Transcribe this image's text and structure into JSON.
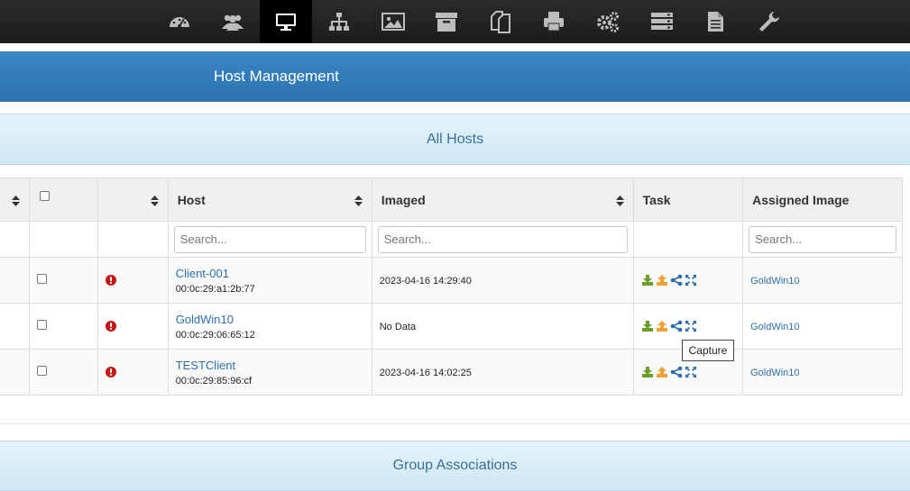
{
  "nav": {
    "items": [
      {
        "name": "dashboard-icon"
      },
      {
        "name": "users-icon"
      },
      {
        "name": "monitor-icon",
        "active": true
      },
      {
        "name": "sitemap-icon"
      },
      {
        "name": "image-icon"
      },
      {
        "name": "archive-icon"
      },
      {
        "name": "copy-icon"
      },
      {
        "name": "printer-icon"
      },
      {
        "name": "gears-icon"
      },
      {
        "name": "server-icon"
      },
      {
        "name": "file-icon"
      },
      {
        "name": "wrench-icon"
      }
    ]
  },
  "header": {
    "title": "Host Management"
  },
  "sections": {
    "all_hosts": "All Hosts",
    "group_associations": "Group Associations"
  },
  "table": {
    "columns": {
      "host": "Host",
      "imaged": "Imaged",
      "task": "Task",
      "assigned_image": "Assigned Image"
    },
    "filters": {
      "host_placeholder": "Search...",
      "imaged_placeholder": "Search...",
      "assigned_placeholder": "Search..."
    },
    "rows": [
      {
        "host": "Client-001",
        "mac": "00:0c:29:a1:2b:77",
        "imaged": "2023-04-16 14:29:40",
        "assigned_image": "GoldWin10"
      },
      {
        "host": "GoldWin10",
        "mac": "00:0c:29:06:65:12",
        "imaged": "No Data",
        "assigned_image": "GoldWin10"
      },
      {
        "host": "TESTClient",
        "mac": "00:0c:29:85:96:cf",
        "imaged": "2023-04-16 14:02:25",
        "assigned_image": "GoldWin10"
      }
    ]
  },
  "tooltip": "Capture",
  "colors": {
    "accent": "#2c73b1",
    "link": "#2a6fad",
    "alert": "#cc1111",
    "deploy": "#6a9f2a",
    "capture": "#f0a030"
  }
}
